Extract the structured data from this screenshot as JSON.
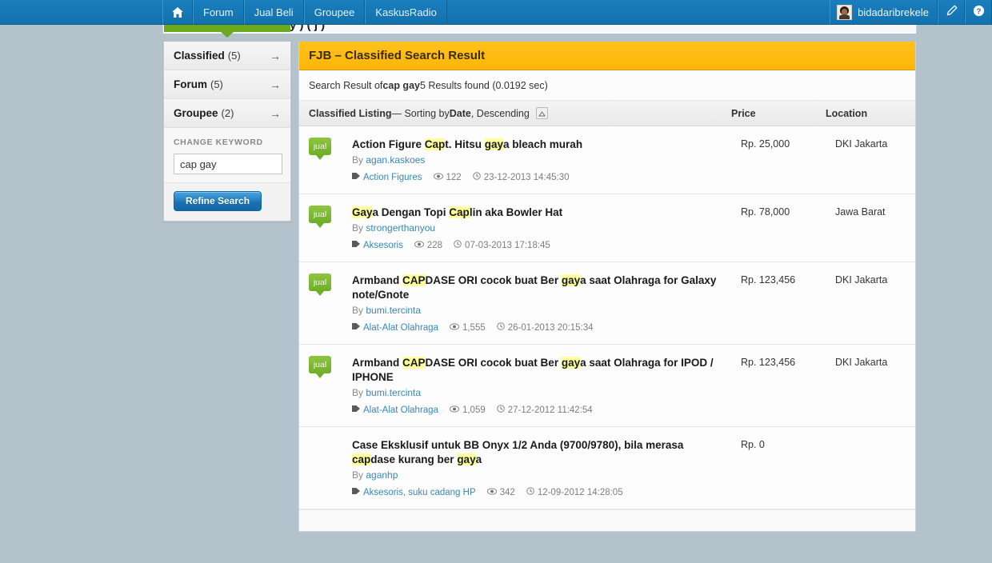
{
  "topnav": {
    "home_icon": "home-icon",
    "items": [
      "Forum",
      "Jual Beli",
      "Groupee",
      "KaskusRadio"
    ],
    "username": "bidadaribrekele",
    "edit_icon": "pencil-icon",
    "help_icon": "help-icon"
  },
  "page_strip": {
    "clipped_text": "y   )  ( j )"
  },
  "sidebar": {
    "links": [
      {
        "label": "Classified",
        "count": "(5)",
        "arrow": "→"
      },
      {
        "label": "Forum",
        "count": "(5)",
        "arrow": "→"
      },
      {
        "label": "Groupee",
        "count": "(2)",
        "arrow": "→"
      }
    ],
    "change_keyword_label": "CHANGE KEYWORD",
    "keyword_value": "cap gay",
    "keyword_placeholder": "cap gay",
    "refine_button": "Refine Search"
  },
  "main": {
    "title": "FJB – Classified Search Result",
    "summary_prefix": "Search Result of ",
    "summary_term": "cap gay",
    "summary_suffix": " 5 Results found (0.0192 sec)",
    "list_header": {
      "title": "Classified Listing",
      "sort_prefix": " — Sorting by ",
      "sort_field": "Date",
      "sort_dir": ", Descending",
      "sort_icon": "caret-up-icon",
      "price_col": "Price",
      "location_col": "Location"
    },
    "by_prefix": "By ",
    "badge_label": "jual",
    "results": [
      {
        "badge": "jual",
        "title_parts": [
          {
            "t": "Action Figure ",
            "hl": false
          },
          {
            "t": "Cap",
            "hl": true
          },
          {
            "t": "t. Hitsu ",
            "hl": false
          },
          {
            "t": "gay",
            "hl": true
          },
          {
            "t": "a bleach murah",
            "hl": false
          }
        ],
        "author": "agan.kaskoes",
        "category": "Action Figures",
        "views": "122",
        "date": "23-12-2013 14:45:30",
        "price": "Rp. 25,000",
        "location": "DKI Jakarta"
      },
      {
        "badge": "jual",
        "title_parts": [
          {
            "t": "Gay",
            "hl": true
          },
          {
            "t": "a Dengan Topi ",
            "hl": false
          },
          {
            "t": "Cap",
            "hl": true
          },
          {
            "t": "lin aka Bowler Hat",
            "hl": false
          }
        ],
        "author": "strongerthanyou",
        "category": "Aksesoris",
        "views": "228",
        "date": "07-03-2013 17:18:45",
        "price": "Rp. 78,000",
        "location": "Jawa Barat"
      },
      {
        "badge": "jual",
        "title_parts": [
          {
            "t": "Armband ",
            "hl": false
          },
          {
            "t": "CAP",
            "hl": true
          },
          {
            "t": "DASE ORI cocok buat Ber ",
            "hl": false
          },
          {
            "t": "gay",
            "hl": true
          },
          {
            "t": "a saat Olahraga for Galaxy note/Gnote",
            "hl": false
          }
        ],
        "author": "bumi.tercinta",
        "category": "Alat-Alat Olahraga",
        "views": "1,555",
        "date": "26-01-2013 20:15:34",
        "price": "Rp. 123,456",
        "location": "DKI Jakarta"
      },
      {
        "badge": "jual",
        "title_parts": [
          {
            "t": "Armband ",
            "hl": false
          },
          {
            "t": "CAP",
            "hl": true
          },
          {
            "t": "DASE ORI cocok buat Ber ",
            "hl": false
          },
          {
            "t": "gay",
            "hl": true
          },
          {
            "t": "a saat Olahraga for IPOD / IPHONE",
            "hl": false
          }
        ],
        "author": "bumi.tercinta",
        "category": "Alat-Alat Olahraga",
        "views": "1,059",
        "date": "27-12-2012 11:42:54",
        "price": "Rp. 123,456",
        "location": "DKI Jakarta"
      },
      {
        "badge": "",
        "title_parts": [
          {
            "t": "Case Eksklusif untuk BB Onyx 1/2 Anda (9700/9780), bila merasa ",
            "hl": false
          },
          {
            "t": "cap",
            "hl": true
          },
          {
            "t": "dase kurang ber ",
            "hl": false
          },
          {
            "t": "gay",
            "hl": true
          },
          {
            "t": "a",
            "hl": false
          }
        ],
        "author": "aganhp",
        "category": "Aksesoris, suku cadang HP",
        "views": "342",
        "date": "12-09-2012 14:28:05",
        "price": "Rp. 0",
        "location": ""
      }
    ]
  },
  "colors": {
    "nav_blue": "#1272ad",
    "title_yellow": "#fdb60a",
    "badge_green": "#6fae29",
    "link_blue": "#3a86b8",
    "highlight": "#ffff9e",
    "page_bg": "#b4c2cc"
  }
}
